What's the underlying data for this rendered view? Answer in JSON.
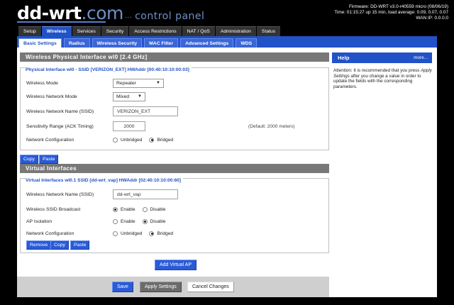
{
  "header": {
    "logo_main": "dd-wrt",
    "logo_suffix": ".com",
    "panel_title": "control panel",
    "panel_dots": "...",
    "firmware": "Firmware: DD-WRT v3.0-r40559 micro (08/06/19)",
    "time": "Time: 01:15:27 up 15 min, load average: 0.09, 0.07, 0.07",
    "wan_ip": "WAN IP: 0.0.0.0"
  },
  "main_tabs": [
    "Setup",
    "Wireless",
    "Services",
    "Security",
    "Access Restrictions",
    "NAT / QoS",
    "Administration",
    "Status"
  ],
  "sub_tabs": [
    "Basic Settings",
    "Radius",
    "Wireless Security",
    "MAC Filter",
    "Advanced Settings",
    "WDS"
  ],
  "physical": {
    "section_title": "Wireless Physical Interface wl0 [2.4 GHz]",
    "legend": "Physical Interface wl0 - SSID [VERIZON_EXT] HWAddr [00:40:10:10:00:03]",
    "mode_label": "Wireless Mode",
    "mode_value": "Repeater",
    "netmode_label": "Wireless Network Mode",
    "netmode_value": "Mixed",
    "ssid_label": "Wireless Network Name (SSID)",
    "ssid_value": "VERIZON_EXT",
    "ack_label": "Sensitivity Range (ACK Timing)",
    "ack_value": "2000",
    "ack_default": "(Default: 2000 meters)",
    "netconf_label": "Network Configuration",
    "opt_unbridged": "Unbridged",
    "opt_bridged": "Bridged"
  },
  "copy_label": "Copy",
  "paste_label": "Paste",
  "virtual": {
    "section_title": "Virtual Interfaces",
    "legend": "Virtual Interfaces wl0.1 SSID [dd-wrt_vap] HWAddr [02:40:10:10:00:60]",
    "ssid_label": "Wireless Network Name (SSID)",
    "ssid_value": "dd-wrt_vap",
    "broadcast_label": "Wireless SSID Broadcast",
    "isolation_label": "AP Isolation",
    "netconf_label": "Network Configuration",
    "opt_enable": "Enable",
    "opt_disable": "Disable",
    "opt_unbridged": "Unbridged",
    "opt_bridged": "Bridged",
    "remove_label": "Remove",
    "copy_label": "Copy",
    "paste_label": "Paste"
  },
  "add_virtual_ap": "Add Virtual AP",
  "footer": {
    "save": "Save",
    "apply": "Apply Settings",
    "cancel": "Cancel Changes"
  },
  "help": {
    "title": "Help",
    "more": "more...",
    "text_1": "Attention: It is recommended that you press ",
    "text_em": "Apply Settings",
    "text_2": " after you change a value in order to update the fields with the corresponding parameters."
  },
  "colors": {
    "accent": "#2252c7",
    "section_bar": "#787878"
  }
}
